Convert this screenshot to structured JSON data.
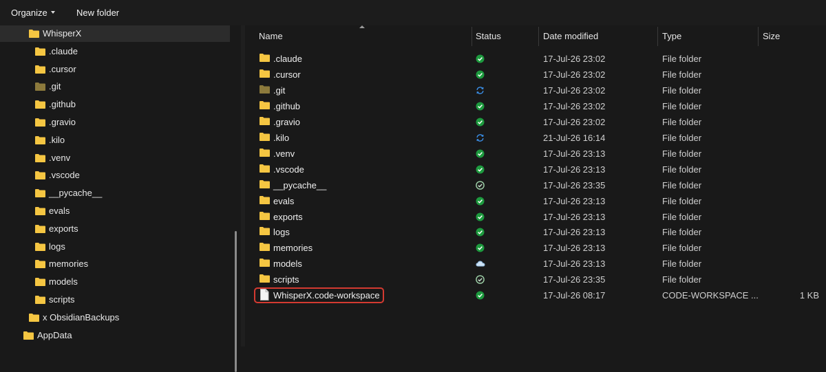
{
  "toolbar": {
    "organize": "Organize",
    "new_folder": "New folder"
  },
  "nav": {
    "items": [
      {
        "label": "WhisperX",
        "level": 1,
        "selected": true,
        "color": "yellow"
      },
      {
        "label": ".claude",
        "level": 2,
        "color": "yellow"
      },
      {
        "label": ".cursor",
        "level": 2,
        "color": "yellow"
      },
      {
        "label": ".git",
        "level": 2,
        "color": "dim"
      },
      {
        "label": ".github",
        "level": 2,
        "color": "yellow"
      },
      {
        "label": ".gravio",
        "level": 2,
        "color": "yellow"
      },
      {
        "label": ".kilo",
        "level": 2,
        "color": "yellow"
      },
      {
        "label": ".venv",
        "level": 2,
        "color": "yellow"
      },
      {
        "label": ".vscode",
        "level": 2,
        "color": "yellow"
      },
      {
        "label": "__pycache__",
        "level": 2,
        "color": "yellow"
      },
      {
        "label": "evals",
        "level": 2,
        "color": "yellow"
      },
      {
        "label": "exports",
        "level": 2,
        "color": "yellow"
      },
      {
        "label": "logs",
        "level": 2,
        "color": "yellow"
      },
      {
        "label": "memories",
        "level": 2,
        "color": "yellow"
      },
      {
        "label": "models",
        "level": 2,
        "color": "yellow"
      },
      {
        "label": "scripts",
        "level": 2,
        "color": "yellow"
      },
      {
        "label": "x ObsidianBackups",
        "level": 1,
        "color": "yellow"
      },
      {
        "label": "AppData",
        "level": 0,
        "color": "yellow"
      }
    ]
  },
  "columns": {
    "name": "Name",
    "status": "Status",
    "date": "Date modified",
    "type": "Type",
    "size": "Size"
  },
  "files": [
    {
      "name": ".claude",
      "status": "synced",
      "date": "17-Jul-26 23:02",
      "type": "File folder",
      "size": "",
      "icon": "folder"
    },
    {
      "name": ".cursor",
      "status": "synced",
      "date": "17-Jul-26 23:02",
      "type": "File folder",
      "size": "",
      "icon": "folder"
    },
    {
      "name": ".git",
      "status": "syncing",
      "date": "17-Jul-26 23:02",
      "type": "File folder",
      "size": "",
      "icon": "folder-dim"
    },
    {
      "name": ".github",
      "status": "synced",
      "date": "17-Jul-26 23:02",
      "type": "File folder",
      "size": "",
      "icon": "folder"
    },
    {
      "name": ".gravio",
      "status": "synced",
      "date": "17-Jul-26 23:02",
      "type": "File folder",
      "size": "",
      "icon": "folder"
    },
    {
      "name": ".kilo",
      "status": "syncing",
      "date": "21-Jul-26 16:14",
      "type": "File folder",
      "size": "",
      "icon": "folder"
    },
    {
      "name": ".venv",
      "status": "synced",
      "date": "17-Jul-26 23:13",
      "type": "File folder",
      "size": "",
      "icon": "folder"
    },
    {
      "name": ".vscode",
      "status": "synced",
      "date": "17-Jul-26 23:13",
      "type": "File folder",
      "size": "",
      "icon": "folder"
    },
    {
      "name": "__pycache__",
      "status": "available",
      "date": "17-Jul-26 23:35",
      "type": "File folder",
      "size": "",
      "icon": "folder"
    },
    {
      "name": "evals",
      "status": "synced",
      "date": "17-Jul-26 23:13",
      "type": "File folder",
      "size": "",
      "icon": "folder"
    },
    {
      "name": "exports",
      "status": "synced",
      "date": "17-Jul-26 23:13",
      "type": "File folder",
      "size": "",
      "icon": "folder"
    },
    {
      "name": "logs",
      "status": "synced",
      "date": "17-Jul-26 23:13",
      "type": "File folder",
      "size": "",
      "icon": "folder"
    },
    {
      "name": "memories",
      "status": "synced",
      "date": "17-Jul-26 23:13",
      "type": "File folder",
      "size": "",
      "icon": "folder"
    },
    {
      "name": "models",
      "status": "cloud",
      "date": "17-Jul-26 23:13",
      "type": "File folder",
      "size": "",
      "icon": "folder"
    },
    {
      "name": "scripts",
      "status": "available",
      "date": "17-Jul-26 23:35",
      "type": "File folder",
      "size": "",
      "icon": "folder"
    },
    {
      "name": "WhisperX.code-workspace",
      "status": "synced",
      "date": "17-Jul-26 08:17",
      "type": "CODE-WORKSPACE ...",
      "size": "1 KB",
      "icon": "file",
      "highlighted": true
    }
  ],
  "colors": {
    "folder": "#f5c542",
    "folder_dim": "#8c7a3c",
    "synced": "#1d9a3e",
    "syncing": "#3a8ee6",
    "highlight": "#d43a31"
  }
}
